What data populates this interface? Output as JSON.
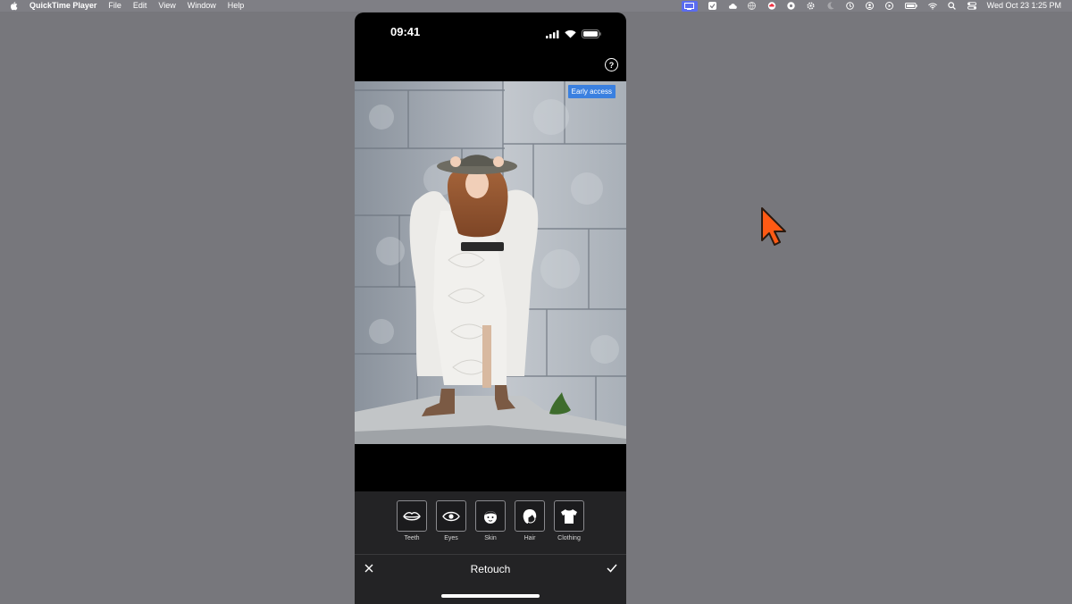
{
  "menubar": {
    "app_name": "QuickTime Player",
    "menus": [
      "File",
      "Edit",
      "View",
      "Window",
      "Help"
    ],
    "clock": "Wed Oct 23  1:25 PM",
    "status_icons": [
      "screen-recording-icon",
      "checkmark-shield-icon",
      "cloud-icon",
      "globe-icon",
      "creative-cloud-icon",
      "chrome-icon",
      "gear-icon",
      "moon-icon",
      "history-icon",
      "user-icon",
      "play-icon",
      "battery-icon",
      "wifi-icon",
      "search-icon",
      "control-center-icon"
    ]
  },
  "phone": {
    "status_time": "09:41",
    "badge": "Early access",
    "help_symbol": "?",
    "tools": [
      {
        "label": "Teeth",
        "icon": "lips-icon"
      },
      {
        "label": "Eyes",
        "icon": "eye-icon"
      },
      {
        "label": "Skin",
        "icon": "face-icon"
      },
      {
        "label": "Hair",
        "icon": "hair-icon"
      },
      {
        "label": "Clothing",
        "icon": "shirt-icon"
      }
    ],
    "screen_title": "Retouch"
  },
  "colors": {
    "desktop": "#77777c",
    "badge": "#3a80e0",
    "cursor": "#ff5a14"
  }
}
